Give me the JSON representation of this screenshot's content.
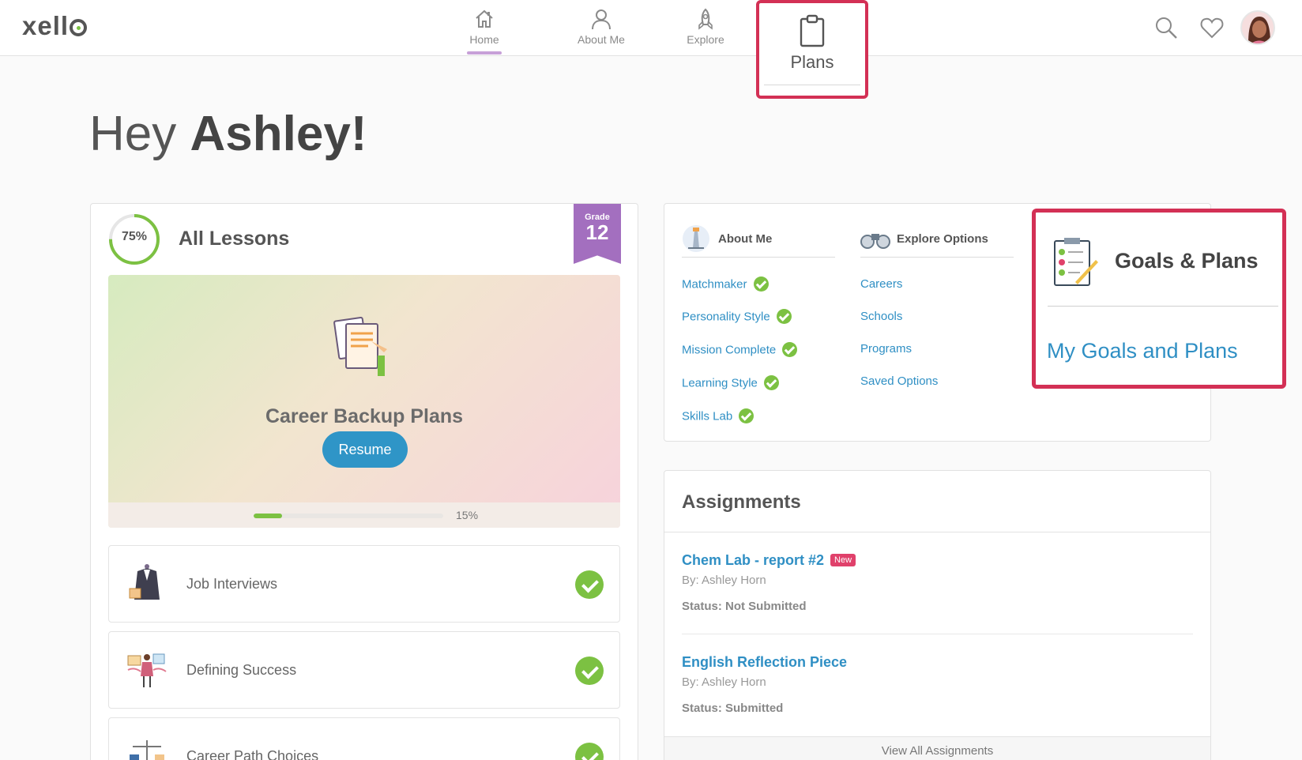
{
  "header": {
    "logo": "xell",
    "nav": {
      "home": "Home",
      "about": "About Me",
      "explore": "Explore",
      "plans": "Plans"
    },
    "icons": [
      "search-icon",
      "heart-icon",
      "avatar"
    ]
  },
  "greeting": {
    "prefix": "Hey",
    "name": "Ashley!"
  },
  "lessons": {
    "progress_label": "75%",
    "progress": 0.75,
    "title": "All Lessons",
    "grade_label": "Grade",
    "grade": "12",
    "feature": {
      "title": "Career Backup Plans",
      "button": "Resume",
      "progress_label": "15%",
      "progress": 0.15
    },
    "items": [
      {
        "label": "Job Interviews"
      },
      {
        "label": "Defining Success"
      },
      {
        "label": "Career Path Choices"
      }
    ]
  },
  "about": {
    "heading": "About Me",
    "links": [
      "Matchmaker",
      "Personality Style",
      "Mission Complete",
      "Learning Style",
      "Skills Lab"
    ]
  },
  "explore": {
    "heading": "Explore Options",
    "links": [
      "Careers",
      "Schools",
      "Programs",
      "Saved Options"
    ]
  },
  "goals": {
    "heading": "Goals & Plans",
    "link": "My Goals and Plans"
  },
  "assignments": {
    "heading": "Assignments",
    "items": [
      {
        "title": "Chem Lab - report #2",
        "badge": "New",
        "by": "By: Ashley Horn",
        "status": "Status: Not Submitted"
      },
      {
        "title": "English Reflection Piece",
        "by": "By: Ashley Horn",
        "status": "Status: Submitted"
      }
    ],
    "view_all": "View All Assignments"
  },
  "colors": {
    "accent_red": "#d33055",
    "link_blue": "#2f8fc4",
    "check_green": "#7cc142",
    "grade_purple": "#a36fbf"
  }
}
